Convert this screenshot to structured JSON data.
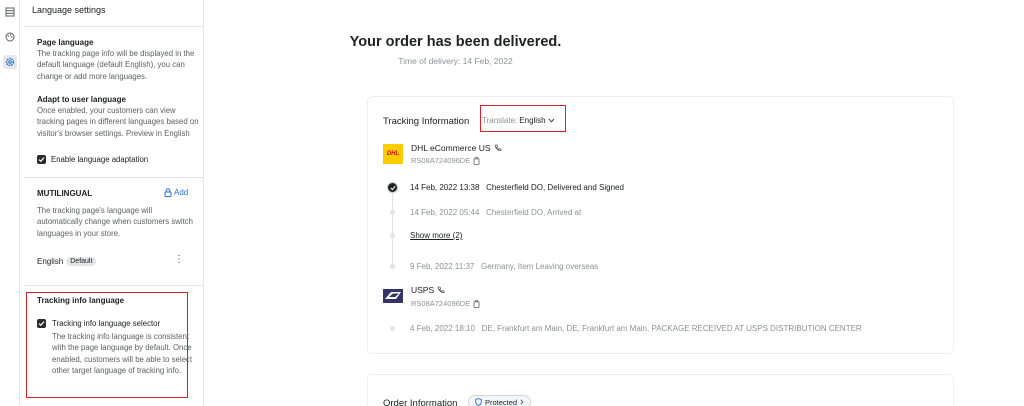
{
  "rail": {
    "icons": [
      "list-icon",
      "palette-icon",
      "gear-icon"
    ]
  },
  "panel": {
    "header": "Language settings",
    "page_language": {
      "title": "Page language",
      "text": "The tracking page info will be displayed in the default language (default English), you can change or add more languages."
    },
    "adapt": {
      "title": "Adapt to user language",
      "text": "Once enabled, your customers can view tracking pages in different languages based on visitor's browser settings. Preview in English",
      "checkbox_label": "Enable language adaptation",
      "checked": true
    },
    "multilingual": {
      "title": "MUTILINGUAL",
      "add_label": "Add",
      "text": "The tracking page's language will automatically change when customers switch languages in your store.",
      "language": "English",
      "default_badge": "Default"
    },
    "tracking_info_language": {
      "title": "Tracking info language",
      "checkbox_label": "Tracking info language selector",
      "checked": true,
      "text": "The tracking info language is consistent with the page language by default. Once enabled, customers will be able to select other target language of tracking info."
    }
  },
  "main": {
    "title": "Your order has been delivered.",
    "subtitle": "Time of delivery: 14 Feb, 2022",
    "tracking_card": {
      "title": "Tracking Information",
      "translate_prefix": "Translate:",
      "translate_value": "English",
      "carriers": [
        {
          "name": "DHL eCommerce US",
          "logo": "dhl-logo",
          "logo_text": "DHL",
          "tracking_number": "RS08A724096DE",
          "events": [
            {
              "time": "14 Feb, 2022 13:38",
              "desc": "Chesterfield DO, Delivered and Signed"
            },
            {
              "time": "14 Feb, 2022 05:44",
              "desc": "Chesterfield DO, Arrived at"
            },
            {
              "time": "9 Feb, 2022 11:37",
              "desc": "Germany, Item Leaving overseas"
            }
          ],
          "show_more": "Show more (2)"
        },
        {
          "name": "USPS",
          "logo": "usps-logo",
          "tracking_number": "RS08A724096DE",
          "events": [
            {
              "time": "4 Feb, 2022 18:10",
              "desc": "DE, Frankfurt am Main, DE, Frankfurt am Main, PACKAGE RECEIVED AT USPS DISTRIBUTION CENTER"
            }
          ]
        }
      ]
    },
    "order_card": {
      "title": "Order Information",
      "badge": "Protected"
    }
  },
  "colors": {
    "highlight": "#d8232a",
    "link": "#2c6ecb",
    "dhl_yellow": "#ffcc00",
    "dhl_red": "#d40511",
    "usps_blue": "#333366"
  }
}
